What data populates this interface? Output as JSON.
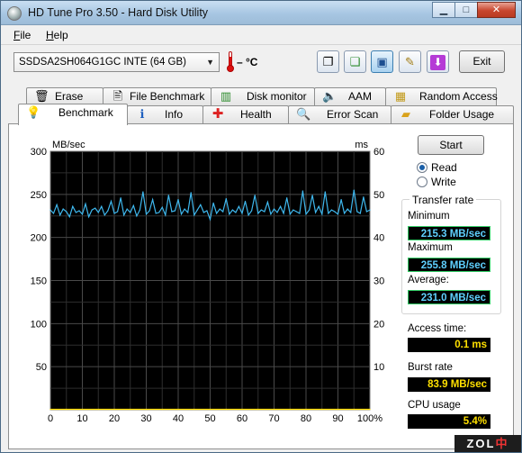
{
  "window": {
    "title": "HD Tune Pro 3.50 - Hard Disk Utility",
    "min_label": "▁",
    "max_label": "□",
    "close_label": "✕"
  },
  "menu": [
    "File",
    "Help"
  ],
  "toolbar": {
    "drive": "SSDSA2SH064G1GC INTE (64 GB)",
    "temperature": "– °C",
    "exit_label": "Exit",
    "icons": [
      "copy-icon",
      "copy-all-icon",
      "save-icon",
      "options-icon",
      "download-icon"
    ]
  },
  "tabs": {
    "row1": [
      {
        "label": "Erase",
        "icon": "erase-icon"
      },
      {
        "label": "File Benchmark",
        "icon": "file-benchmark-icon"
      },
      {
        "label": "Disk monitor",
        "icon": "disk-monitor-icon"
      },
      {
        "label": "AAM",
        "icon": "speaker-icon"
      },
      {
        "label": "Random Access",
        "icon": "random-access-icon"
      }
    ],
    "row2": [
      {
        "label": "Benchmark",
        "icon": "lightbulb-icon",
        "active": true
      },
      {
        "label": "Info",
        "icon": "info-icon"
      },
      {
        "label": "Health",
        "icon": "health-cross-icon"
      },
      {
        "label": "Error Scan",
        "icon": "magnifier-icon"
      },
      {
        "label": "Folder Usage",
        "icon": "folder-icon"
      }
    ]
  },
  "controls": {
    "start_label": "Start",
    "mode_options": [
      "Read",
      "Write"
    ],
    "mode_selected": "Read"
  },
  "stats": {
    "transfer_rate_title": "Transfer rate",
    "minimum_label": "Minimum",
    "minimum_value": "215.3 MB/sec",
    "maximum_label": "Maximum",
    "maximum_value": "255.8 MB/sec",
    "average_label": "Average:",
    "average_value": "231.0 MB/sec",
    "access_time_label": "Access time:",
    "access_time_value": "0.1 ms",
    "burst_rate_label": "Burst rate",
    "burst_rate_value": "83.9 MB/sec",
    "cpu_label": "CPU usage",
    "cpu_value": "5.4%"
  },
  "watermark": {
    "left": "ZOL",
    "right": "中关村在线"
  },
  "chart_data": {
    "type": "line",
    "ylabel_left": "MB/sec",
    "ylabel_right": "ms",
    "xlabel": "",
    "xlim": [
      0,
      100
    ],
    "ylim_left": [
      0,
      300
    ],
    "ylim_right": [
      0,
      60
    ],
    "x_ticks": [
      "0",
      "10",
      "20",
      "30",
      "40",
      "50",
      "60",
      "70",
      "80",
      "90",
      "100%"
    ],
    "y_ticks_left": [
      "50",
      "100",
      "150",
      "200",
      "250",
      "300"
    ],
    "y_ticks_right": [
      "10",
      "20",
      "30",
      "40",
      "50",
      "60"
    ],
    "grid": true,
    "background": "#000000",
    "series": [
      {
        "color": "#3fb8ee",
        "axis": "left",
        "x": [
          0,
          1,
          2,
          3,
          4,
          5,
          6,
          7,
          8,
          9,
          10,
          11,
          12,
          13,
          14,
          15,
          16,
          17,
          18,
          19,
          20,
          21,
          22,
          23,
          24,
          25,
          26,
          27,
          28,
          29,
          30,
          31,
          32,
          33,
          34,
          35,
          36,
          37,
          38,
          39,
          40,
          41,
          42,
          43,
          44,
          45,
          46,
          47,
          48,
          49,
          50,
          51,
          52,
          53,
          54,
          55,
          56,
          57,
          58,
          59,
          60,
          61,
          62,
          63,
          64,
          65,
          66,
          67,
          68,
          69,
          70,
          71,
          72,
          73,
          74,
          75,
          76,
          77,
          78,
          79,
          80,
          81,
          82,
          83,
          84,
          85,
          86,
          87,
          88,
          89,
          90,
          91,
          92,
          93,
          94,
          95,
          96,
          97,
          98,
          99,
          100
        ],
        "y": [
          232,
          228,
          238,
          226,
          233,
          230,
          224,
          236,
          229,
          231,
          227,
          239,
          224,
          232,
          234,
          229,
          236,
          226,
          231,
          242,
          228,
          230,
          246,
          226,
          233,
          229,
          237,
          225,
          232,
          253,
          227,
          231,
          244,
          228,
          229,
          235,
          226,
          249,
          230,
          231,
          244,
          227,
          233,
          229,
          252,
          226,
          232,
          238,
          229,
          231,
          221,
          240,
          228,
          233,
          230,
          245,
          227,
          232,
          229,
          236,
          228,
          242,
          226,
          231,
          249,
          228,
          232,
          230,
          241,
          227,
          233,
          229,
          236,
          228,
          246,
          227,
          232,
          230,
          228,
          254,
          227,
          232,
          249,
          229,
          236,
          227,
          253,
          228,
          232,
          230,
          227,
          244,
          228,
          233,
          229,
          255,
          230,
          228,
          247,
          230,
          232
        ]
      },
      {
        "color": "#ffe000",
        "axis": "right",
        "x": [
          0,
          5,
          10,
          15,
          20,
          25,
          30,
          35,
          40,
          45,
          50,
          55,
          60,
          65,
          70,
          75,
          80,
          85,
          90,
          95,
          100
        ],
        "y": [
          0.1,
          0.1,
          0.1,
          0.1,
          0.1,
          0.1,
          0.1,
          0.1,
          0.1,
          0.1,
          0.1,
          0.1,
          0.1,
          0.1,
          0.1,
          0.1,
          0.1,
          0.1,
          0.1,
          0.1,
          0.1
        ]
      }
    ]
  }
}
